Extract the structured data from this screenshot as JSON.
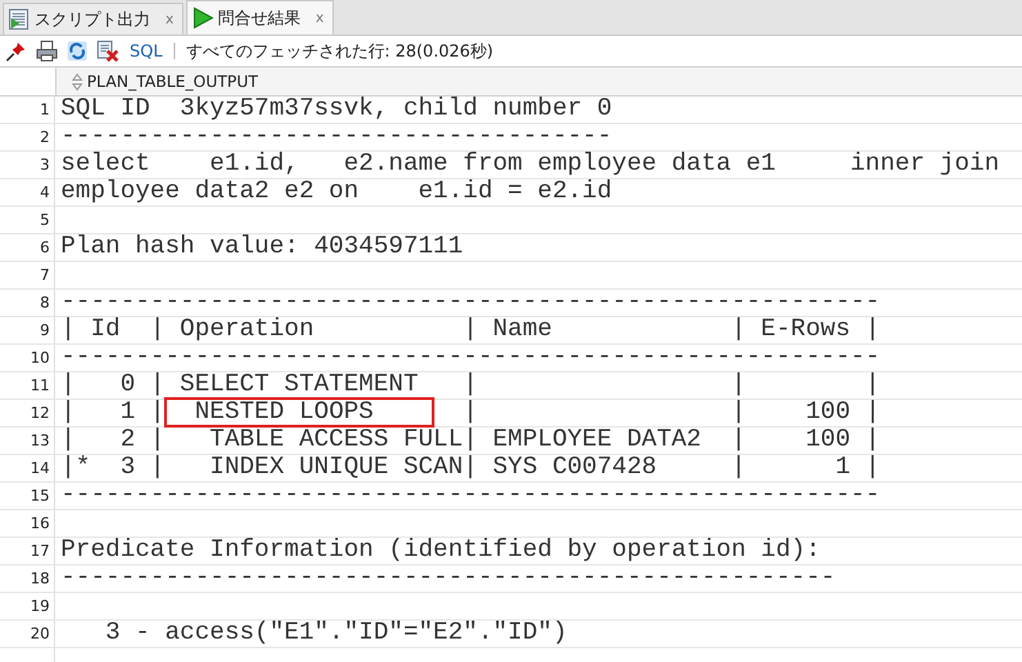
{
  "tabs": [
    {
      "label": "スクリプト出力",
      "kind": "script",
      "selected": false,
      "close": "x"
    },
    {
      "label": "問合せ結果",
      "kind": "query",
      "selected": true,
      "close": "x"
    }
  ],
  "toolbar": {
    "buttons": [
      {
        "kind": "pin"
      },
      {
        "kind": "print"
      },
      {
        "kind": "refresh"
      },
      {
        "kind": "delete"
      }
    ],
    "sql_link": "SQL",
    "status": "すべてのフェッチされた行: 28(0.026秒)"
  },
  "column_header": "PLAN_TABLE_OUTPUT",
  "rows": [
    {
      "number": "1",
      "text": "SQL ID  3kyz57m37ssvk, child number 0"
    },
    {
      "number": "2",
      "text": "-------------------------------------"
    },
    {
      "number": "3",
      "text": "select    e1.id,   e2.name from employee data e1     inner join"
    },
    {
      "number": "4",
      "text": "employee data2 e2 on    e1.id = e2.id"
    },
    {
      "number": "5",
      "text": ""
    },
    {
      "number": "6",
      "text": "Plan hash value: 4034597111"
    },
    {
      "number": "7",
      "text": ""
    },
    {
      "number": "8",
      "text": "-------------------------------------------------------"
    },
    {
      "number": "9",
      "text": "| Id  | Operation          | Name            | E-Rows |"
    },
    {
      "number": "10",
      "text": "-------------------------------------------------------"
    },
    {
      "number": "11",
      "text": "|   0 | SELECT STATEMENT   |                 |        |"
    },
    {
      "number": "12",
      "segments": [
        {
          "text": "|   1 |",
          "marked": false
        },
        {
          "text": "  NESTED LOOPS    ",
          "marked": true
        },
        {
          "text": "  |                 |    100 |",
          "marked": false
        }
      ]
    },
    {
      "number": "13",
      "text": "|   2 |   TABLE ACCESS FULL| EMPLOYEE DATA2  |    100 |"
    },
    {
      "number": "14",
      "text": "|*  3 |   INDEX UNIQUE SCAN| SYS C007428     |      1 |"
    },
    {
      "number": "15",
      "text": "-------------------------------------------------------"
    },
    {
      "number": "16",
      "text": ""
    },
    {
      "number": "17",
      "text": "Predicate Information (identified by operation id):"
    },
    {
      "number": "18",
      "text": "----------------------------------------------------"
    },
    {
      "number": "19",
      "text": ""
    },
    {
      "number": "20",
      "text": "   3 - access(\"E1\".\"ID\"=\"E2\".\"ID\")"
    }
  ]
}
